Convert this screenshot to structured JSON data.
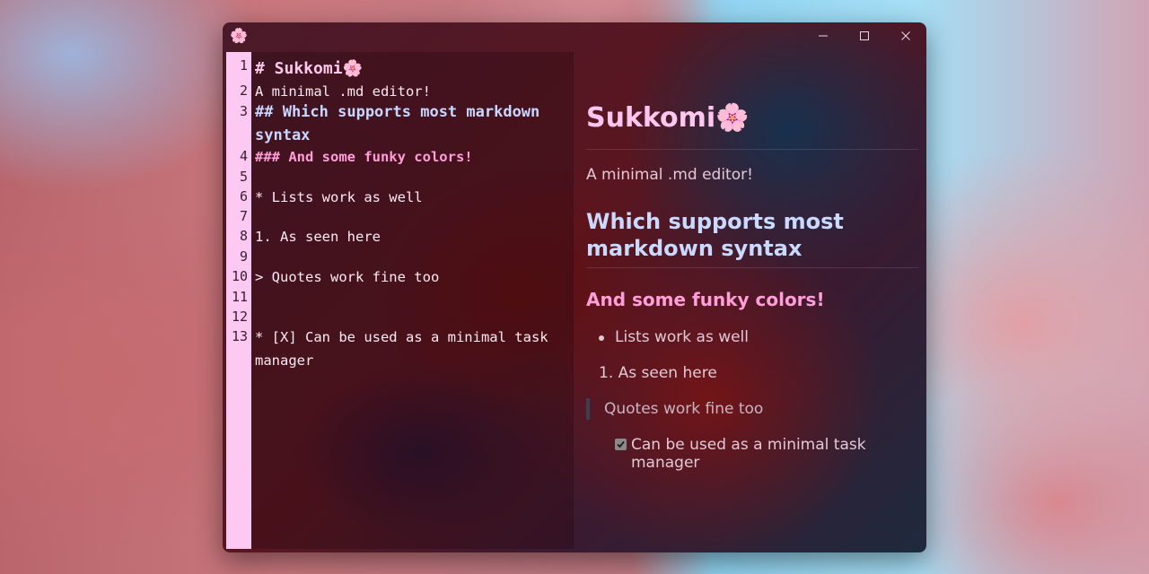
{
  "window": {
    "app_icon": "🌸",
    "controls": [
      "minimize-icon",
      "maximize-icon",
      "close-icon"
    ]
  },
  "editor": {
    "line_numbers": [
      "1",
      "2",
      "3",
      "4",
      "5",
      "6",
      "7",
      "8",
      "9",
      "10",
      "11",
      "12",
      "13"
    ],
    "lines": [
      {
        "text": "# Sukkomi🌸",
        "style": "h1"
      },
      {
        "text": "A minimal .md editor!",
        "style": "text"
      },
      {
        "text": "## Which supports most markdown syntax",
        "style": "h2"
      },
      {
        "text": "### And some funky colors!",
        "style": "h3"
      },
      {
        "text": "",
        "style": "text"
      },
      {
        "text": "* Lists work as well",
        "style": "text"
      },
      {
        "text": "",
        "style": "text"
      },
      {
        "text": "1. As seen here",
        "style": "text"
      },
      {
        "text": "",
        "style": "text"
      },
      {
        "text": "> Quotes work fine too",
        "style": "text"
      },
      {
        "text": "",
        "style": "text"
      },
      {
        "text": "",
        "style": "text"
      },
      {
        "text": "* [X] Can be used as a minimal task manager",
        "style": "text"
      }
    ]
  },
  "preview": {
    "h1": "Sukkomi🌸",
    "paragraph": "A minimal .md editor!",
    "h2": "Which supports most markdown syntax",
    "h3": "And some funky colors!",
    "bullet_item": "Lists work as well",
    "ordered_item": "1. As seen here",
    "quote": "Quotes work fine too",
    "task": {
      "checked": true,
      "label": "Can be used as a minimal task manager"
    }
  },
  "colors": {
    "gutter": "#fdc9f3",
    "h1": "#ffc7ef",
    "h2": "#c9d9ff",
    "h3": "#ff9ed9"
  }
}
